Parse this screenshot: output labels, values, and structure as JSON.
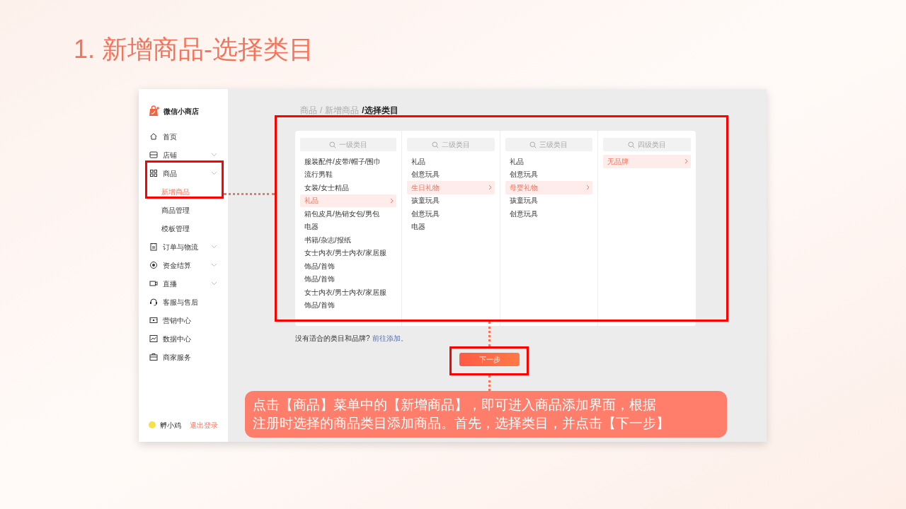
{
  "slide": {
    "title": "1. 新增商品-选择类目"
  },
  "app": {
    "brand": "微信小商店",
    "nav": [
      {
        "label": "首页",
        "expandable": false
      },
      {
        "label": "店铺",
        "expandable": true
      },
      {
        "label": "商品",
        "expandable": true,
        "children": [
          {
            "label": "新增商品",
            "selected": true
          },
          {
            "label": "商品管理",
            "selected": false
          },
          {
            "label": "模板管理",
            "selected": false
          }
        ]
      },
      {
        "label": "订单与物流",
        "expandable": true
      },
      {
        "label": "资金结算",
        "expandable": true
      },
      {
        "label": "直播",
        "expandable": true
      },
      {
        "label": "客服与售后",
        "expandable": false
      },
      {
        "label": "营销中心",
        "expandable": false
      },
      {
        "label": "数据中心",
        "expandable": false
      },
      {
        "label": "商家服务",
        "expandable": false
      }
    ],
    "user": {
      "name": "孵小鸡",
      "logout": "退出登录"
    }
  },
  "breadcrumb": [
    {
      "label": "商品",
      "current": false
    },
    {
      "separator": "/",
      "label": "新增商品",
      "current": false
    },
    {
      "separator": "/",
      "label": "选择类目",
      "current": true
    }
  ],
  "columns": [
    {
      "placeholder": "一级类目",
      "items": [
        {
          "label": "服装配件/皮带/帽子/围巾",
          "selected": false
        },
        {
          "label": "流行男鞋",
          "selected": false
        },
        {
          "label": "女装/女士精品",
          "selected": false
        },
        {
          "label": "礼品",
          "selected": true
        },
        {
          "label": "箱包皮具/热销女包/男包",
          "selected": false
        },
        {
          "label": "电器",
          "selected": false
        },
        {
          "label": "书籍/杂志/报纸",
          "selected": false
        },
        {
          "label": "女士内衣/男士内衣/家居服",
          "selected": false
        },
        {
          "label": "饰品/首饰",
          "selected": false
        },
        {
          "label": "饰品/首饰",
          "selected": false
        },
        {
          "label": "女士内衣/男士内衣/家居服",
          "selected": false
        },
        {
          "label": "饰品/首饰",
          "selected": false
        }
      ]
    },
    {
      "placeholder": "二级类目",
      "items": [
        {
          "label": "礼品",
          "selected": false
        },
        {
          "label": "创意玩具",
          "selected": false
        },
        {
          "label": "生日礼物",
          "selected": true
        },
        {
          "label": "孩童玩具",
          "selected": false
        },
        {
          "label": "创意玩具",
          "selected": false
        },
        {
          "label": "电器",
          "selected": false
        }
      ]
    },
    {
      "placeholder": "三级类目",
      "items": [
        {
          "label": "礼品",
          "selected": false
        },
        {
          "label": "创意玩具",
          "selected": false
        },
        {
          "label": "母婴礼物",
          "selected": true
        },
        {
          "label": "孩童玩具",
          "selected": false
        },
        {
          "label": "创意玩具",
          "selected": false
        }
      ]
    },
    {
      "placeholder": "四级类目",
      "items": [
        {
          "label": "无品牌",
          "selected": true
        }
      ]
    }
  ],
  "hint": {
    "text": "没有适合的类目和品牌?",
    "link": "前往添加。"
  },
  "next_button": "下一步",
  "callout": {
    "lines": [
      "点击【商品】菜单中的【新增商品】，即可进入商品添加界面，根据",
      "注册时选择的商品类目添加商品。首先，选择类目，并点击【下一步】"
    ]
  }
}
